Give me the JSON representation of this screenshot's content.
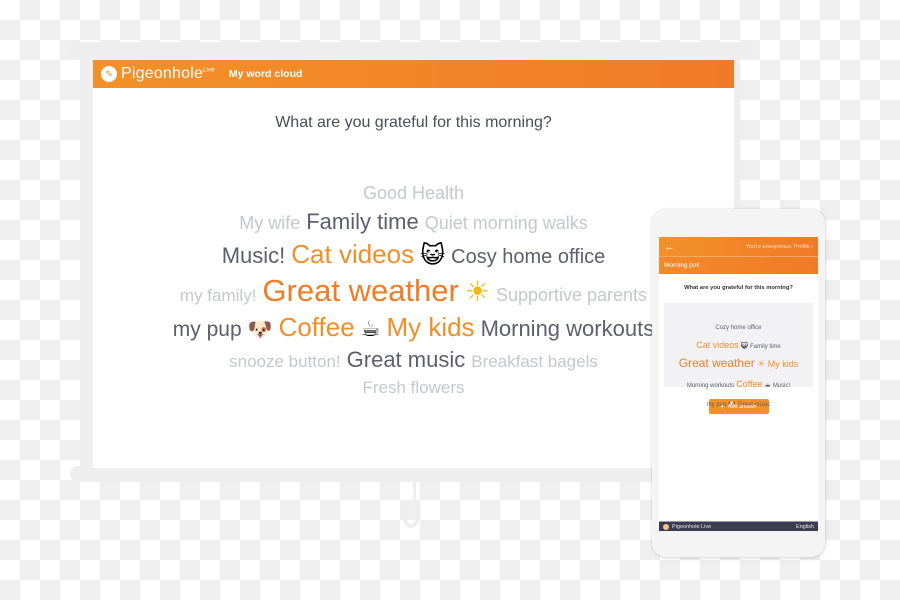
{
  "app": {
    "brand": "Pigeonhole",
    "brand_suffix": "Live",
    "title": "My word cloud"
  },
  "presentation": {
    "question": "What are you grateful for this morning?",
    "cloud_rows": [
      [
        {
          "text": "Good Health",
          "style": "light",
          "size": 18
        }
      ],
      [
        {
          "text": "My wife",
          "style": "light",
          "size": 18
        },
        {
          "text": "Family time",
          "style": "dark",
          "size": 22
        },
        {
          "text": "Quiet morning walks",
          "style": "light",
          "size": 18
        }
      ],
      [
        {
          "text": "Music!",
          "style": "dark",
          "size": 22
        },
        {
          "text": "Cat videos",
          "style": "orange",
          "size": 26
        },
        {
          "text": "😺",
          "style": "emoji",
          "size": 24,
          "icon": "smiling-cat-emoji"
        },
        {
          "text": "Cosy home office",
          "style": "dark",
          "size": 20
        }
      ],
      [
        {
          "text": "my family!",
          "style": "light",
          "size": 17
        },
        {
          "text": "Great weather",
          "style": "orange2",
          "size": 31
        },
        {
          "text": "☀",
          "style": "emoji-sun",
          "size": 28,
          "icon": "sun-emoji"
        },
        {
          "text": "Supportive parents",
          "style": "light",
          "size": 18
        }
      ],
      [
        {
          "text": "my pup",
          "style": "dark",
          "size": 21
        },
        {
          "text": "🐶",
          "style": "emoji",
          "size": 20,
          "icon": "dog-emoji"
        },
        {
          "text": "Coffee",
          "style": "orange",
          "size": 26
        },
        {
          "text": "☕",
          "style": "emoji",
          "size": 22,
          "icon": "coffee-emoji"
        },
        {
          "text": "My kids",
          "style": "orange",
          "size": 26
        },
        {
          "text": "Morning workouts",
          "style": "dark",
          "size": 22
        }
      ],
      [
        {
          "text": "snooze button!",
          "style": "light",
          "size": 17
        },
        {
          "text": "Great music",
          "style": "dark",
          "size": 22
        },
        {
          "text": "Breakfast bagels",
          "style": "light",
          "size": 17
        }
      ],
      [
        {
          "text": "Fresh flowers",
          "style": "light",
          "size": 17
        }
      ]
    ]
  },
  "phone": {
    "back_icon": "←",
    "profile_link": "You're anonymous. Profile ›",
    "section_title": "Morning poll",
    "question": "What are you grateful for this morning?",
    "cloud_rows": [
      [
        {
          "text": "Cozy home office",
          "style": "dark",
          "size": 6
        }
      ],
      [
        {
          "text": "Cat videos",
          "style": "orange",
          "size": 9
        },
        {
          "text": "😺",
          "style": "emoji",
          "size": 7,
          "icon": "smiling-cat-emoji"
        },
        {
          "text": "Family time",
          "style": "dark",
          "size": 6
        }
      ],
      [
        {
          "text": "Great weather",
          "style": "orange2",
          "size": 12
        },
        {
          "text": "☀",
          "style": "emoji-sun",
          "size": 10,
          "icon": "sun-emoji"
        },
        {
          "text": "My kids",
          "style": "orange",
          "size": 9
        }
      ],
      [
        {
          "text": "Morning workouts",
          "style": "dark",
          "size": 6
        },
        {
          "text": "Coffee",
          "style": "orange",
          "size": 9
        },
        {
          "text": "☕",
          "style": "emoji",
          "size": 7,
          "icon": "coffee-emoji"
        },
        {
          "text": "Music!",
          "style": "dark",
          "size": 6
        }
      ],
      [
        {
          "text": "my pup",
          "style": "dark",
          "size": 6
        },
        {
          "text": "🐶",
          "style": "emoji",
          "size": 6,
          "icon": "dog-emoji"
        },
        {
          "text": "Great music",
          "style": "dark",
          "size": 6
        }
      ]
    ],
    "add_answer_label": "Add answer",
    "add_icon": "+",
    "footer_brand": "Pigeonhole Live",
    "footer_language": "English"
  },
  "colors": {
    "brand_orange": "#f08f2a",
    "brand_orange_dark": "#f07a28",
    "word_light": "#c5c7ce",
    "word_dark": "#5c5f6e",
    "footer_bg": "#3b3c50"
  }
}
